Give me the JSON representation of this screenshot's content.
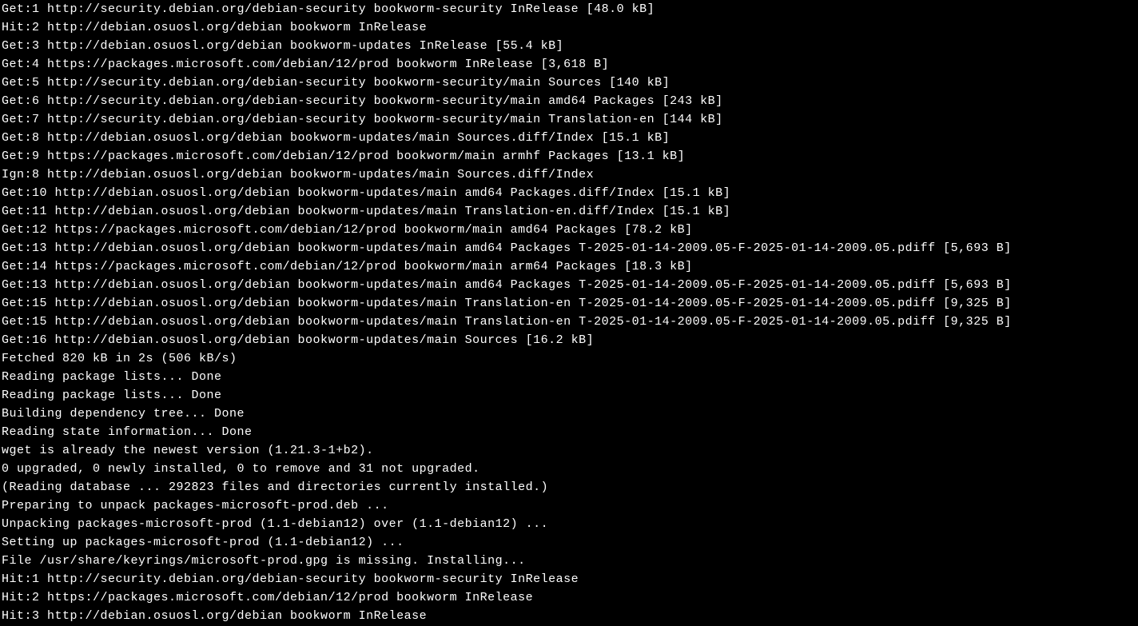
{
  "terminal": {
    "lines": [
      "Get:1 http://security.debian.org/debian-security bookworm-security InRelease [48.0 kB]",
      "Hit:2 http://debian.osuosl.org/debian bookworm InRelease",
      "Get:3 http://debian.osuosl.org/debian bookworm-updates InRelease [55.4 kB]",
      "Get:4 https://packages.microsoft.com/debian/12/prod bookworm InRelease [3,618 B]",
      "Get:5 http://security.debian.org/debian-security bookworm-security/main Sources [140 kB]",
      "Get:6 http://security.debian.org/debian-security bookworm-security/main amd64 Packages [243 kB]",
      "Get:7 http://security.debian.org/debian-security bookworm-security/main Translation-en [144 kB]",
      "Get:8 http://debian.osuosl.org/debian bookworm-updates/main Sources.diff/Index [15.1 kB]",
      "Get:9 https://packages.microsoft.com/debian/12/prod bookworm/main armhf Packages [13.1 kB]",
      "Ign:8 http://debian.osuosl.org/debian bookworm-updates/main Sources.diff/Index",
      "Get:10 http://debian.osuosl.org/debian bookworm-updates/main amd64 Packages.diff/Index [15.1 kB]",
      "Get:11 http://debian.osuosl.org/debian bookworm-updates/main Translation-en.diff/Index [15.1 kB]",
      "Get:12 https://packages.microsoft.com/debian/12/prod bookworm/main amd64 Packages [78.2 kB]",
      "Get:13 http://debian.osuosl.org/debian bookworm-updates/main amd64 Packages T-2025-01-14-2009.05-F-2025-01-14-2009.05.pdiff [5,693 B]",
      "Get:14 https://packages.microsoft.com/debian/12/prod bookworm/main arm64 Packages [18.3 kB]",
      "Get:13 http://debian.osuosl.org/debian bookworm-updates/main amd64 Packages T-2025-01-14-2009.05-F-2025-01-14-2009.05.pdiff [5,693 B]",
      "Get:15 http://debian.osuosl.org/debian bookworm-updates/main Translation-en T-2025-01-14-2009.05-F-2025-01-14-2009.05.pdiff [9,325 B]",
      "Get:15 http://debian.osuosl.org/debian bookworm-updates/main Translation-en T-2025-01-14-2009.05-F-2025-01-14-2009.05.pdiff [9,325 B]",
      "Get:16 http://debian.osuosl.org/debian bookworm-updates/main Sources [16.2 kB]",
      "Fetched 820 kB in 2s (506 kB/s)",
      "Reading package lists... Done",
      "Reading package lists... Done",
      "Building dependency tree... Done",
      "Reading state information... Done",
      "wget is already the newest version (1.21.3-1+b2).",
      "0 upgraded, 0 newly installed, 0 to remove and 31 not upgraded.",
      "(Reading database ... 292823 files and directories currently installed.)",
      "Preparing to unpack packages-microsoft-prod.deb ...",
      "Unpacking packages-microsoft-prod (1.1-debian12) over (1.1-debian12) ...",
      "Setting up packages-microsoft-prod (1.1-debian12) ...",
      "File /usr/share/keyrings/microsoft-prod.gpg is missing. Installing...",
      "Hit:1 http://security.debian.org/debian-security bookworm-security InRelease",
      "Hit:2 https://packages.microsoft.com/debian/12/prod bookworm InRelease",
      "Hit:3 http://debian.osuosl.org/debian bookworm InRelease"
    ]
  }
}
